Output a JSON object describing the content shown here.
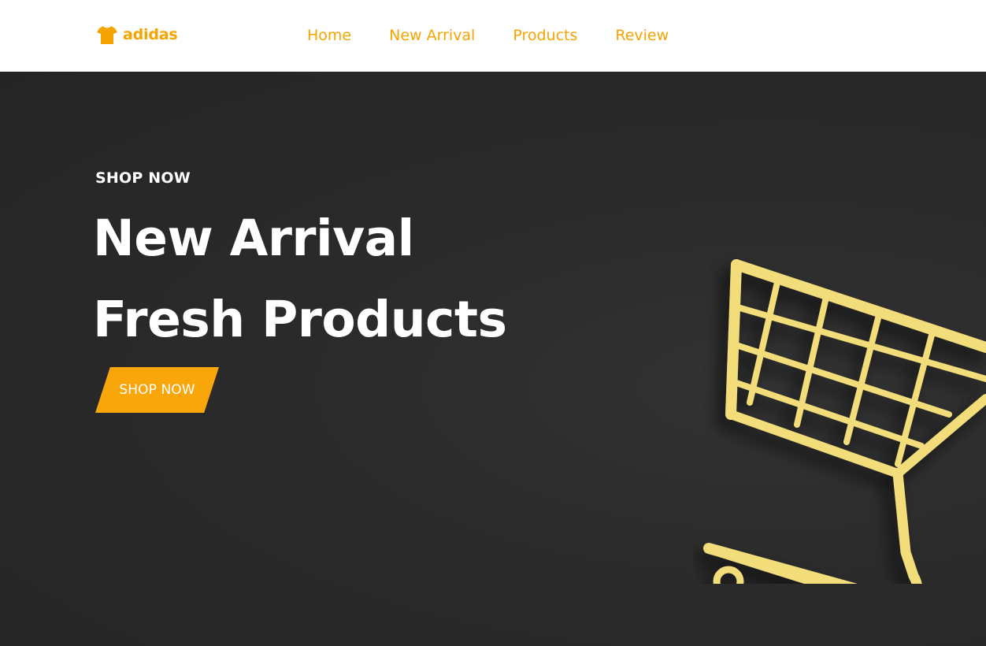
{
  "brand": {
    "name": "adidas",
    "icon": "tshirt-icon",
    "accent_color": "#f5a400"
  },
  "nav": {
    "items": [
      {
        "label": "Home"
      },
      {
        "label": "New Arrival"
      },
      {
        "label": "Products"
      },
      {
        "label": "Review"
      }
    ]
  },
  "hero": {
    "eyebrow": "SHOP NOW",
    "title_line1": "New Arrival",
    "title_line2": "Fresh Products",
    "cta_label": "SHOP NOW",
    "cta_color": "#f9a60b",
    "background_color": "#2a2a2a",
    "image": "shopping-cart-icon",
    "image_color": "#f2dd7a"
  }
}
